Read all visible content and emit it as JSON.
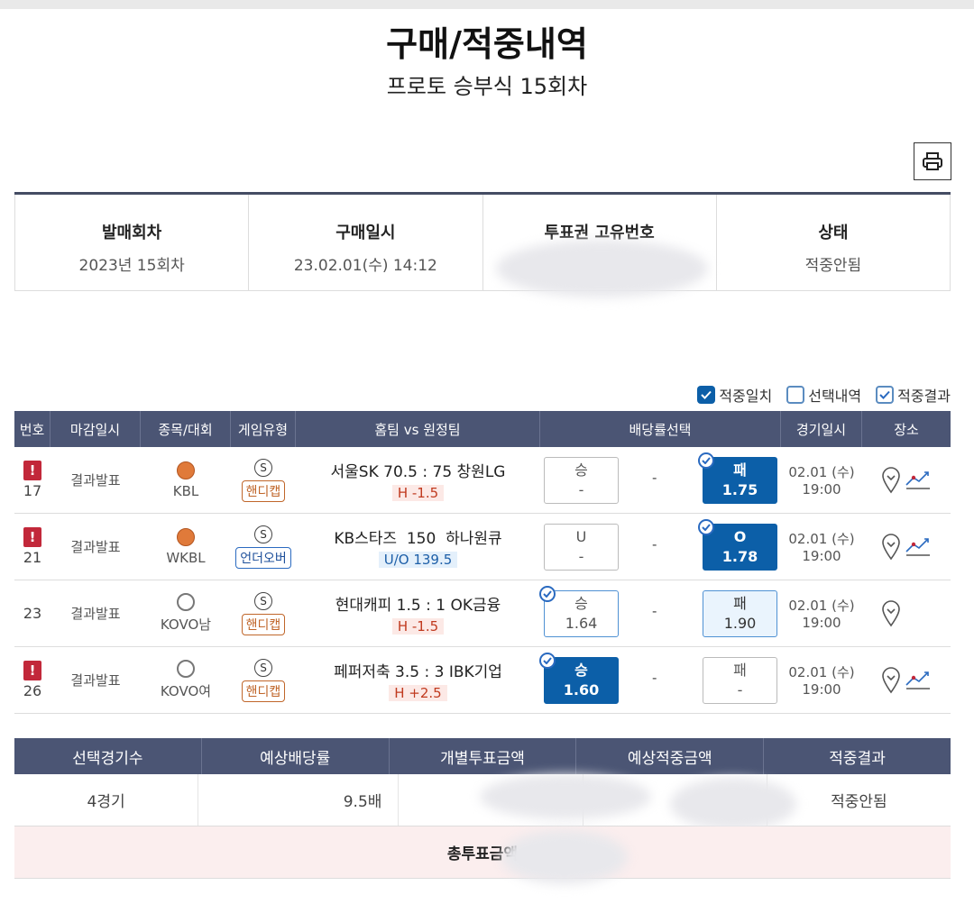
{
  "page": {
    "title": "구매/적중내역",
    "subtitle": "프로토 승부식 15회차"
  },
  "info": [
    {
      "label": "발매회차",
      "value": "2023년 15회차"
    },
    {
      "label": "구매일시",
      "value": "23.02.01(수) 14:12"
    },
    {
      "label": "투표권 고유번호",
      "value": ""
    },
    {
      "label": "상태",
      "value": "적중안됨"
    }
  ],
  "legend": {
    "hit_match": "적중일치",
    "selection": "선택내역",
    "hit_result": "적중결과"
  },
  "table_headers": [
    "번호",
    "마감일시",
    "종목/대회",
    "게임유형",
    "홈팀 vs 원정팀",
    "배당률선택",
    "경기일시",
    "장소"
  ],
  "games": [
    {
      "no": "17",
      "deadline": "결과발표",
      "sport": "KBL",
      "type_code": "S",
      "type": "핸디캡",
      "teams": "서울SK 70.5 : 75 창원LG",
      "handicap": "H -1.5",
      "left": {
        "label": "승",
        "odds": "-"
      },
      "middle": "-",
      "right": {
        "label": "패",
        "odds": "1.75"
      },
      "date": "02.01 (수)",
      "time": "19:00"
    },
    {
      "no": "21",
      "deadline": "결과발표",
      "sport": "WKBL",
      "type_code": "S",
      "type": "언더오버",
      "teams": "KB스타즈  150  하나원큐",
      "handicap": "U/O 139.5",
      "left": {
        "label": "U",
        "odds": "-"
      },
      "middle": "-",
      "right": {
        "label": "O",
        "odds": "1.78"
      },
      "date": "02.01 (수)",
      "time": "19:00"
    },
    {
      "no": "23",
      "deadline": "결과발표",
      "sport": "KOVO남",
      "type_code": "S",
      "type": "핸디캡",
      "teams": "현대캐피 1.5 : 1 OK금융",
      "handicap": "H -1.5",
      "left": {
        "label": "승",
        "odds": "1.64"
      },
      "middle": "-",
      "right": {
        "label": "패",
        "odds": "1.90"
      },
      "date": "02.01 (수)",
      "time": "19:00"
    },
    {
      "no": "26",
      "deadline": "결과발표",
      "sport": "KOVO여",
      "type_code": "S",
      "type": "핸디캡",
      "teams": "페퍼저축 3.5 : 3 IBK기업",
      "handicap": "H +2.5",
      "left": {
        "label": "승",
        "odds": "1.60"
      },
      "middle": "-",
      "right": {
        "label": "패",
        "odds": "-"
      },
      "date": "02.01 (수)",
      "time": "19:00"
    }
  ],
  "summary": {
    "headers": [
      "선택경기수",
      "예상배당률",
      "개별투표금액",
      "예상적중금액",
      "적중결과"
    ],
    "values": [
      "4경기",
      "9.5배",
      "",
      "",
      "적중안됨"
    ],
    "total_label": "총투표금액"
  },
  "colors": {
    "accent": "#0c5fa8",
    "header": "#4b5574",
    "warning": "#c2283a"
  }
}
